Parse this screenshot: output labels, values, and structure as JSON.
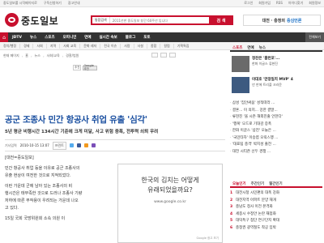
{
  "topbar": {
    "left": [
      "중도일보를 시작페이지로",
      "구독신청하기",
      "광고안내"
    ],
    "right": [
      "로그인",
      "회원가입",
      "RSS",
      "아이디찾기",
      "회원정보"
    ]
  },
  "masthead": {
    "logo": "중도일보",
    "search_scope": "통합검색",
    "search_placeholder": "2011년판 중도일보 창간 60주년 입니다",
    "search_button": "검 색",
    "promo": "대전 · 충청의",
    "promo_highlight": "중심언론"
  },
  "nav": {
    "items": [
      "JDTV",
      "뉴스",
      "스포츠",
      "오피니언",
      "연예",
      "실시간 속보",
      "블로그",
      "포토"
    ],
    "more": "전체보기"
  },
  "subnav": {
    "items": [
      "정치/행정",
      "경제",
      "사회",
      "지역",
      "사회 교육",
      "문화 레저",
      "전국 이슈",
      "사람",
      "사설",
      "종합",
      "칼럼",
      "기획특집"
    ]
  },
  "breadcrumb": [
    "현재 페이지",
    "홈",
    "뉴스",
    "사회/교육",
    "경찰/법원"
  ],
  "share": {
    "pill": "추천",
    "button": "Google 추천"
  },
  "article": {
    "headline": "공군 조종사 민간 항공사 취업 유출 '심각'",
    "subhead": "5년 평균 비행시간 134시간 기준에 크게 미달, 사고 위험 증폭, 전투력 쇠퇴 우려",
    "meta_label": "기사입력",
    "date": "2010-10-15 13:07",
    "print_button": "프린트",
    "body": [
      "[대전=중도일보]",
      "민간 항공사 취업 등을 이유로 공군 조종사의",
      "유출 현상이 여전한 것으로 지적되었다.",
      "이런 가운데 군에 남아 있는 조종사의 비",
      "행시간은 태부족한 것으로 드러나 조종사 기량",
      "저하에 따른 부작용이 우려되는 가운데 나오",
      "고 있다.",
      "15일 국회 국방위원회 소속 의원 이"
    ]
  },
  "ad": {
    "line1": "한국의 김치는 어떻게",
    "line2": "유래되었을까요?",
    "url": "www.google.co.kr",
    "note": "Google 광고 보기"
  },
  "sidebar": {
    "tabs": [
      "스포츠",
      "연예",
      "뉴스"
    ],
    "features": [
      {
        "title": "정찬은 '홈런포'...",
        "desc": "한화 이글스 류현진"
      },
      {
        "title": "이대호 '만장일치 MVP' 4",
        "desc": "년 만에 트리플 크라운"
      }
    ],
    "list": [
      "삼성 '집안싸움' 성적따라 ...",
      "결혼... 이 의지... 강한 결말...",
      "류현진 '올 시즌 해외진출 안한다'",
      "'행복' 모드로 기대감 증폭",
      "한화 이글스 '삼진' 오늘은 ...",
      "'국민타자' 이승엽 오릭스행 ...",
      "'대표팀 충격' 박지성 출전 ...",
      "대전 시티즌 선두 경쟁 ..."
    ]
  },
  "popular": {
    "tabs": [
      "오늘인기",
      "주간인기",
      "월간인기"
    ],
    "items": [
      "대전시청 시민편의 대폭 강화",
      "대전지역 아파트 분양 재개",
      "충남도 청사 이전 본격화",
      "세종시 수정안 논란 재점화",
      "대덕특구 첨단 연구단지 확대",
      "충청권 광역철도 착공 임박"
    ]
  }
}
